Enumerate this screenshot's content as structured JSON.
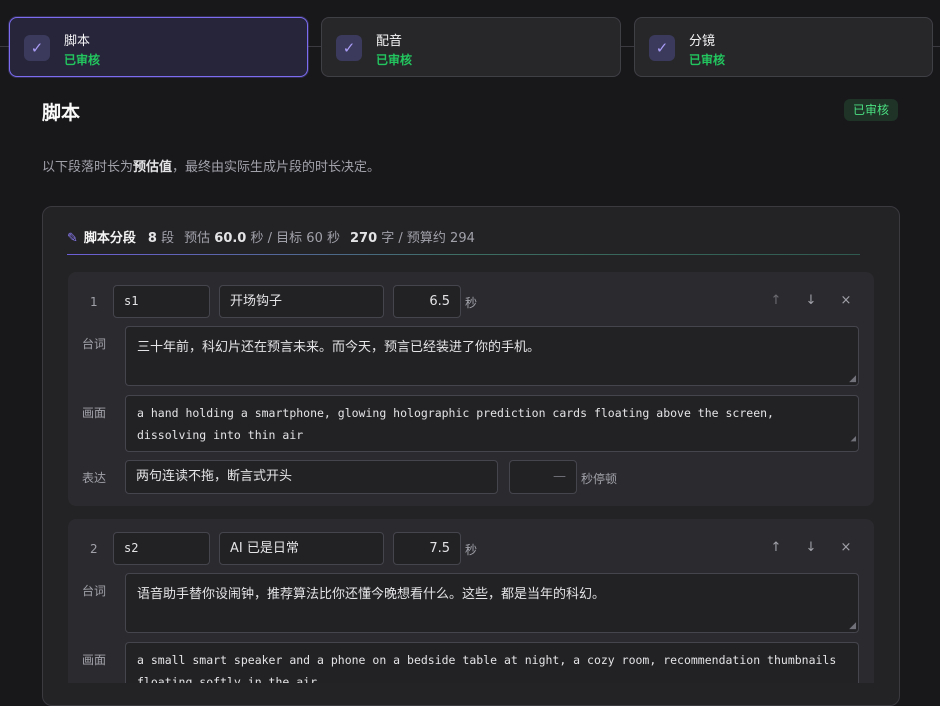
{
  "steps": [
    {
      "title": "脚本",
      "status": "已审核"
    },
    {
      "title": "配音",
      "status": "已审核"
    },
    {
      "title": "分镜",
      "status": "已审核"
    }
  ],
  "check_icon": "✓",
  "page": {
    "title": "脚本",
    "badge": "已审核",
    "note_prefix": "以下段落时长为",
    "note_bold": "预估值",
    "note_suffix": "，最终由实际生成片段的时长决定。"
  },
  "panel": {
    "title": "脚本分段",
    "count_value": "8",
    "count_unit": "段",
    "estimate_label": "预估",
    "estimate_value": "60.0",
    "estimate_unit": "秒",
    "target_text": "/ 目标 60 秒",
    "chars_value": "270",
    "chars_text": "字 / 预算约 294"
  },
  "labels": {
    "line": "台词",
    "visual": "画面",
    "delivery": "表达",
    "seconds_unit": "秒",
    "pause_unit": "秒停顿",
    "up": "↑",
    "down": "↓",
    "remove": "×",
    "grip": "◢"
  },
  "segments": [
    {
      "index": "1",
      "id": "s1",
      "name": "开场钩子",
      "duration": "6.5",
      "line": "三十年前，科幻片还在预言未来。而今天，预言已经装进了你的手机。",
      "visual": "a hand holding a smartphone, glowing holographic prediction cards floating above the screen, dissolving into thin air",
      "delivery": "两句连读不拖，断言式开头",
      "pause": "—"
    },
    {
      "index": "2",
      "id": "s2",
      "name": "AI 已是日常",
      "duration": "7.5",
      "line": "语音助手替你设闹钟，推荐算法比你还懂今晚想看什么。这些，都是当年的科幻。",
      "visual": "a small smart speaker and a phone on a bedside table at night, a cozy room, recommendation thumbnails floating softly in the air"
    }
  ]
}
